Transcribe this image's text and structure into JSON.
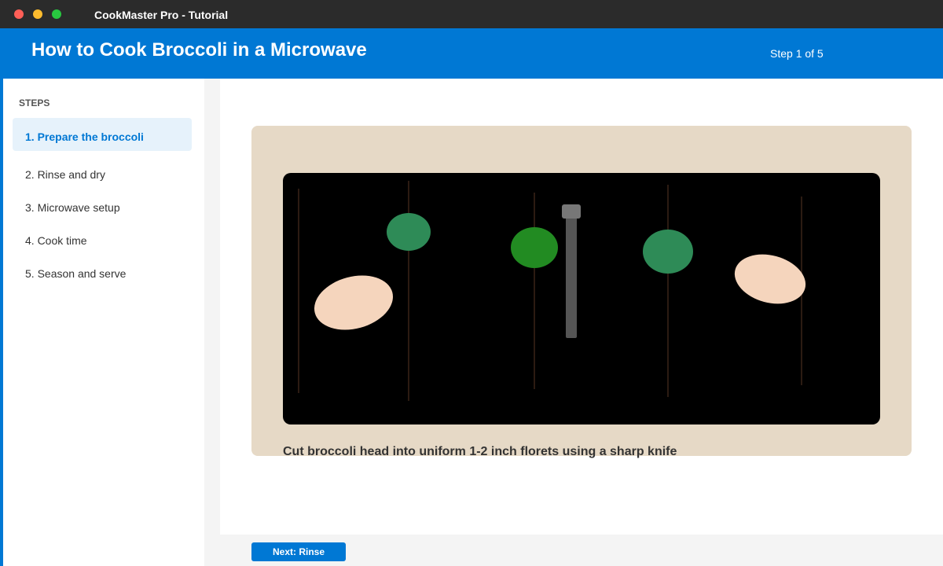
{
  "window": {
    "app_title": "CookMaster Pro - Tutorial"
  },
  "header": {
    "title": "How to Cook Broccoli in a Microwave",
    "step_counter": "Step 1 of 5"
  },
  "sidebar": {
    "heading": "STEPS",
    "items": [
      {
        "label": "1. Prepare the broccoli",
        "active": true
      },
      {
        "label": "2. Rinse and dry",
        "active": false
      },
      {
        "label": "3. Microwave setup",
        "active": false
      },
      {
        "label": "4. Cook time",
        "active": false
      },
      {
        "label": "5. Season and serve",
        "active": false
      }
    ]
  },
  "main": {
    "caption": "Cut broccoli head into uniform 1-2 inch florets using a sharp knife"
  },
  "footer": {
    "next_label": "Next: Rinse"
  },
  "colors": {
    "accent": "#0078d4",
    "titlebar": "#2b2b2b",
    "card_background": "#e6d9c6",
    "video_background": "#000000",
    "floret_green": "#2e8b57",
    "floret_bright_green": "#228b22",
    "stem_peach": "#f5d5bd",
    "knife_gray": "#555555"
  }
}
